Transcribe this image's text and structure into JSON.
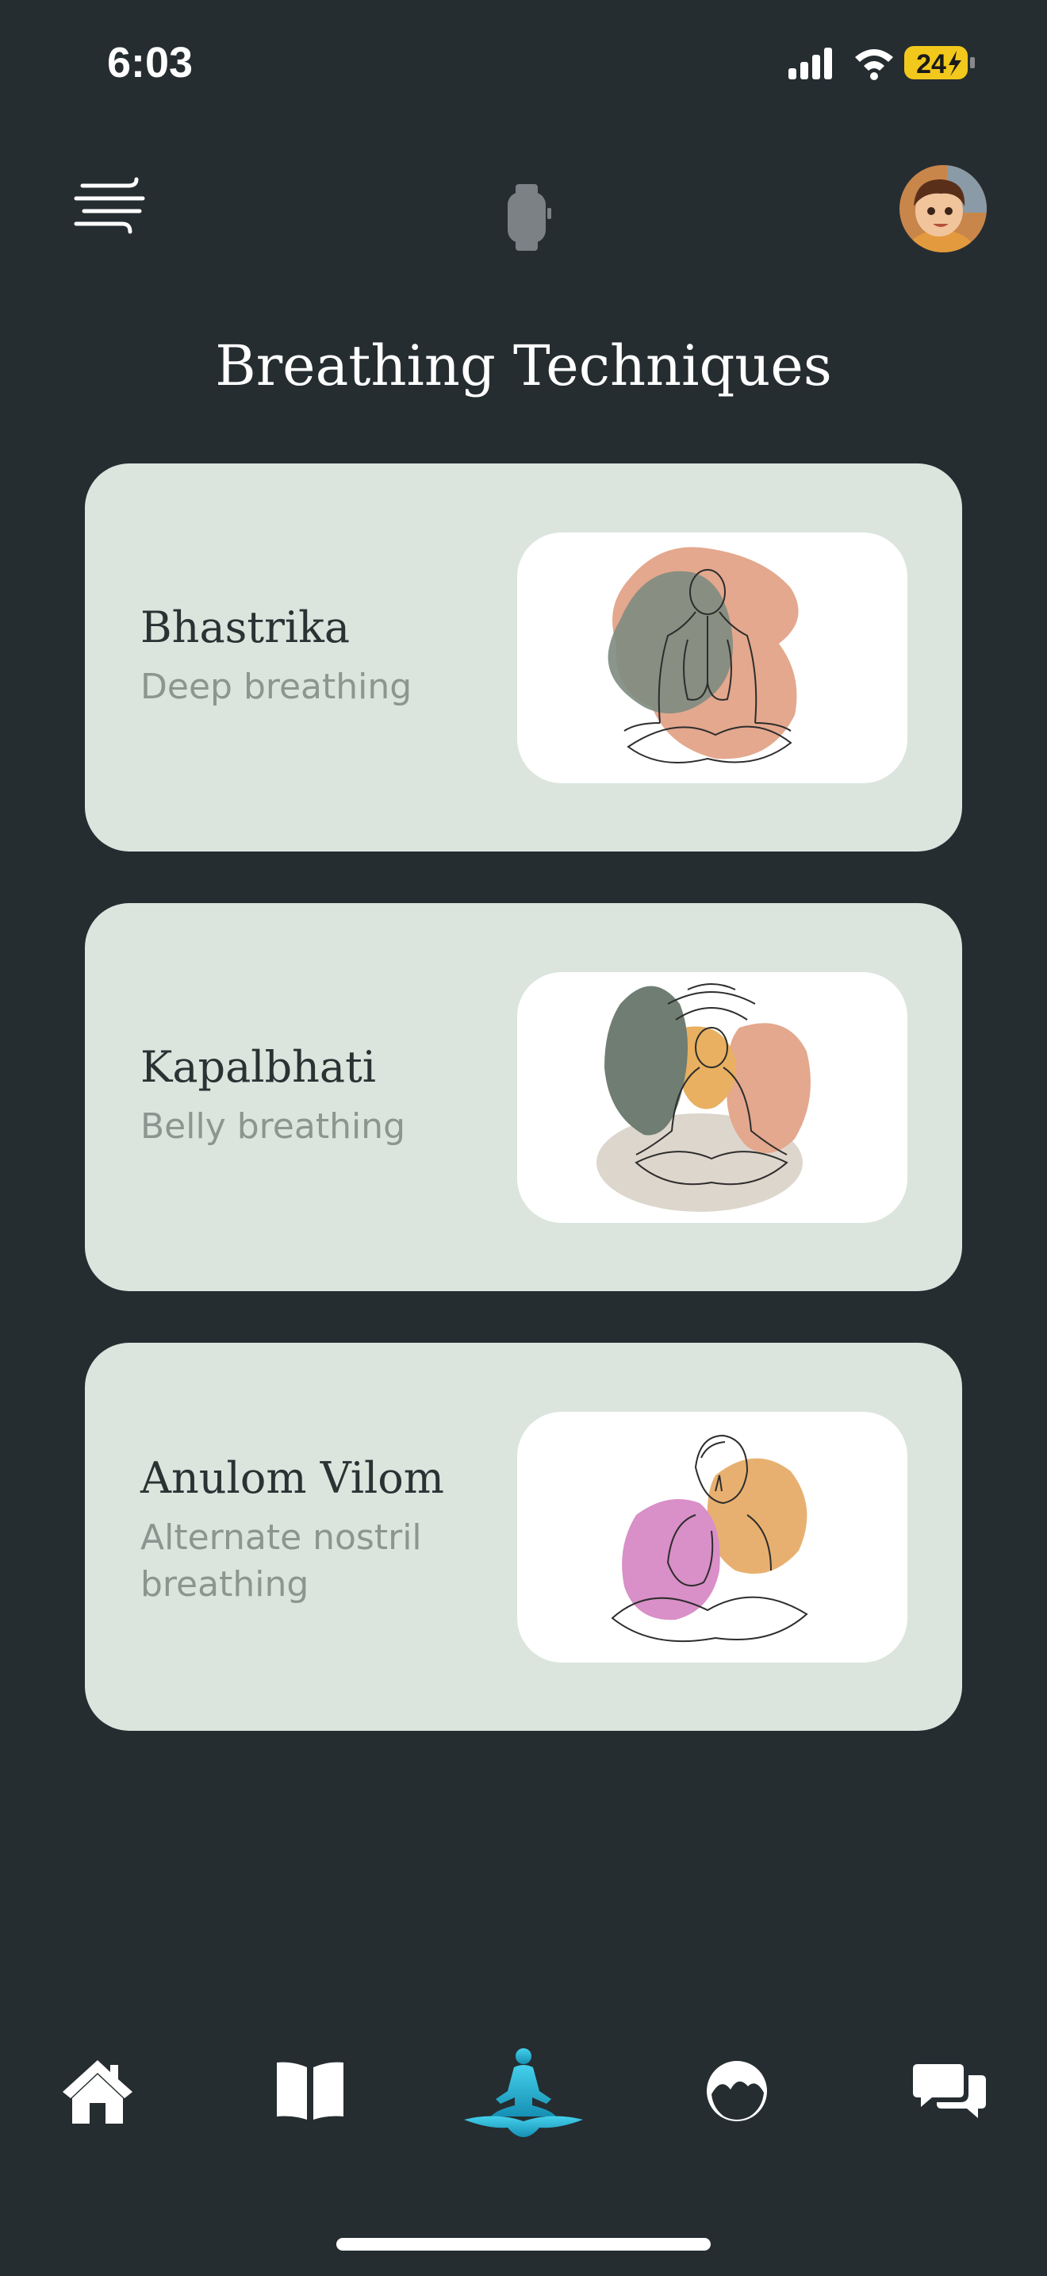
{
  "status_bar": {
    "time": "6:03",
    "battery_level": "24",
    "icons": [
      "signal-icon",
      "wifi-icon",
      "battery-icon"
    ]
  },
  "header": {
    "menu_icon": "wind-lines-icon",
    "center_icon": "watch-icon",
    "avatar_icon": "avatar"
  },
  "page": {
    "title": "Breathing Techniques"
  },
  "techniques": [
    {
      "title": "Bhastrika",
      "subtitle": "Deep breathing",
      "illustration": "meditating-figure-lungs"
    },
    {
      "title": "Kapalbhati",
      "subtitle": "Belly breathing",
      "illustration": "meditating-figure-waves"
    },
    {
      "title": "Anulom Vilom",
      "subtitle": "Alternate nostril breathing",
      "illustration": "figure-nostril-breathing"
    }
  ],
  "tabbar": {
    "items": [
      {
        "icon": "home-icon",
        "active": false
      },
      {
        "icon": "book-icon",
        "active": false
      },
      {
        "icon": "meditation-icon",
        "active": true
      },
      {
        "icon": "moon-icon",
        "active": false
      },
      {
        "icon": "chat-icon",
        "active": false
      }
    ]
  },
  "colors": {
    "background": "#252d31",
    "card": "#dbe5de",
    "accent": "#29b6d9"
  }
}
